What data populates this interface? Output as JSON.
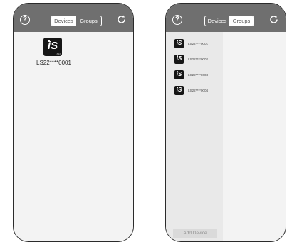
{
  "left_phone": {
    "tabs": [
      {
        "label": "Devices",
        "active": true
      },
      {
        "label": "Groups",
        "active": false
      }
    ],
    "help_icon": "?",
    "device": {
      "logo_text": "iS",
      "logo_sub": "LS22",
      "name": "LS22****0001"
    }
  },
  "right_phone": {
    "tabs": [
      {
        "label": "Devices",
        "active": false
      },
      {
        "label": "Groups",
        "active": true
      }
    ],
    "help_icon": "?",
    "devices": [
      {
        "logo_text": "iS",
        "name": "LS22****0001"
      },
      {
        "logo_text": "iS",
        "name": "LS22****0002"
      },
      {
        "logo_text": "iS",
        "name": "LS22****0003"
      },
      {
        "logo_text": "iS",
        "name": "LS22****0004"
      }
    ],
    "add_device_label": "Add Device"
  },
  "colors": {
    "topbar": "#6f6f6f",
    "content_bg": "#f3f3f3",
    "logo_bg": "#161616"
  }
}
